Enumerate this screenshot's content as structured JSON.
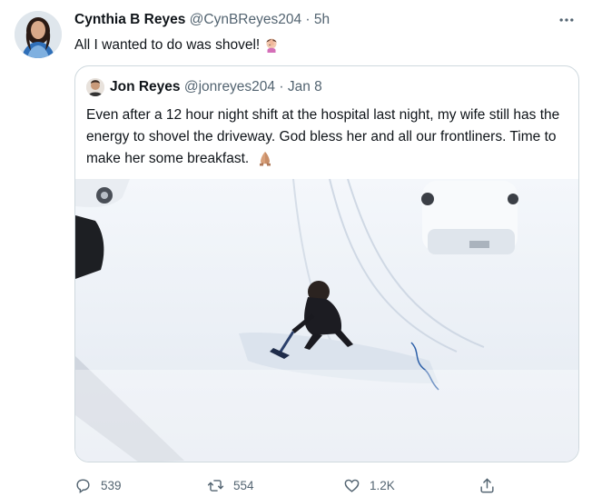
{
  "tweet": {
    "author_name": "Cynthia B Reyes",
    "author_handle": "@CynBReyes204",
    "separator": "·",
    "time": "5h",
    "text": "All I wanted to do was shovel!"
  },
  "quoted_tweet": {
    "author_name": "Jon Reyes",
    "author_handle": "@jonreyes204",
    "separator": "·",
    "time": "Jan 8",
    "text": "Even after a 12 hour night shift at the hospital last night, my wife still has the energy to shovel the driveway. God bless her and all our frontliners. Time to make her some breakfast."
  },
  "actions": {
    "reply_count": "539",
    "retweet_count": "554",
    "like_count": "1.2K"
  },
  "icons": {
    "more": "more-horizontal-icon",
    "reply": "reply-icon",
    "retweet": "retweet-icon",
    "like": "heart-icon",
    "share": "share-icon",
    "facepalm_emoji": "woman-facepalming-emoji",
    "pray_emoji": "folded-hands-emoji"
  },
  "colors": {
    "text_primary": "#0f1419",
    "text_secondary": "#536471",
    "border": "#cfd9de"
  }
}
